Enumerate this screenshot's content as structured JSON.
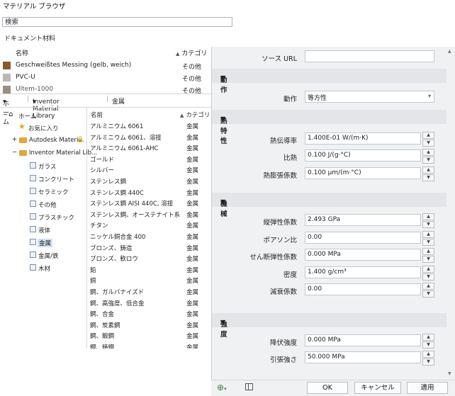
{
  "browser": {
    "title": "マテリアル ブラウザ",
    "search_value": "検索",
    "doc_section_title": "ドキュメント材料",
    "doc_columns": {
      "name": "名称",
      "category": "カテゴリ"
    },
    "doc_rows": [
      {
        "name": "Geschweißtes Messing (gelb, weich)",
        "category": "その他",
        "swatch": "#8a5a2b"
      },
      {
        "name": "PVC-U",
        "category": "その他",
        "swatch": "#b8b8b8"
      },
      {
        "name": "Ultem-1000",
        "category": "その他",
        "swatch": "#9c8f7d"
      }
    ],
    "toolbar": {
      "home": "ホーム",
      "library": "Inventor Material Library",
      "breadcrumb": "金属"
    },
    "tree": [
      {
        "label": "ホーム"
      },
      {
        "label": "お気に入り"
      },
      {
        "label": "Autodesk Materi..."
      },
      {
        "label": "Inventor Material Lib..."
      },
      {
        "label": "ガラス"
      },
      {
        "label": "コンクリート"
      },
      {
        "label": "セラミック"
      },
      {
        "label": "その他"
      },
      {
        "label": "プラスチック"
      },
      {
        "label": "液体"
      },
      {
        "label": "金属"
      },
      {
        "label": "金属/鉄"
      },
      {
        "label": "木材"
      }
    ],
    "list_columns": {
      "name": "名前",
      "category": "カテゴリ"
    },
    "list_rows": [
      {
        "name": "アルミニウム 6061",
        "category": "金属"
      },
      {
        "name": "アルミニウム 6061、溶接",
        "category": "金属"
      },
      {
        "name": "アルミニウム 6061-AHC",
        "category": "金属"
      },
      {
        "name": "ゴールド",
        "category": "金属"
      },
      {
        "name": "シルバー",
        "category": "金属"
      },
      {
        "name": "ステンレス鋼",
        "category": "金属"
      },
      {
        "name": "ステンレス鋼 440C",
        "category": "金属"
      },
      {
        "name": "ステンレス鋼 AISI 440C, 溶接",
        "category": "金属"
      },
      {
        "name": "ステンレス鋼、オーステナイト系",
        "category": "金属"
      },
      {
        "name": "チタン",
        "category": "金属"
      },
      {
        "name": "ニッケル銅合金 400",
        "category": "金属"
      },
      {
        "name": "ブロンズ、鋳造",
        "category": "金属"
      },
      {
        "name": "ブロンズ、軟ロウ",
        "category": "金属"
      },
      {
        "name": "鉛",
        "category": "金属"
      },
      {
        "name": "銅",
        "category": "金属"
      },
      {
        "name": "鋼、ガルバナイズド",
        "category": "金属"
      },
      {
        "name": "鋼、高強度、低合金",
        "category": "金属"
      },
      {
        "name": "鋼、合金",
        "category": "金属"
      },
      {
        "name": "鋼、炭素鋼",
        "category": "金属"
      },
      {
        "name": "鋼、鍛鋼",
        "category": "金属"
      },
      {
        "name": "鋼、鋳鋼",
        "category": "金属"
      }
    ]
  },
  "editor": {
    "source_url_label": "ソース URL",
    "source_url_value": "",
    "sections": {
      "behavior": {
        "title": "動作",
        "behavior_label": "動作",
        "behavior_value": "等方性"
      },
      "thermal": {
        "title": "熱特性",
        "conductivity_label": "熱伝導率",
        "conductivity_value": "1.400E-01 W/(m·K)",
        "specific_heat_label": "比熱",
        "specific_heat_value": "0.100 J/(g·°C)",
        "expansion_label": "熱膨張係数",
        "expansion_value": "0.100 µm/(m·°C)"
      },
      "mechanical": {
        "title": "機械",
        "youngs_label": "縦弾性係数",
        "youngs_value": "2.493 GPa",
        "poisson_label": "ポアソン比",
        "poisson_value": "0.00",
        "shear_label": "せん断弾性係数",
        "shear_value": "0.000 MPa",
        "density_label": "密度",
        "density_value": "1.400 g/cm³",
        "damping_label": "減衰係数",
        "damping_value": "0.00"
      },
      "strength": {
        "title": "強度",
        "yield_label": "降伏強度",
        "yield_value": "0.000 MPa",
        "tensile_label": "引張強さ",
        "tensile_value": "50.000 MPa"
      }
    },
    "buttons": {
      "ok": "OK",
      "cancel": "キャンセル",
      "apply": "適用"
    }
  }
}
